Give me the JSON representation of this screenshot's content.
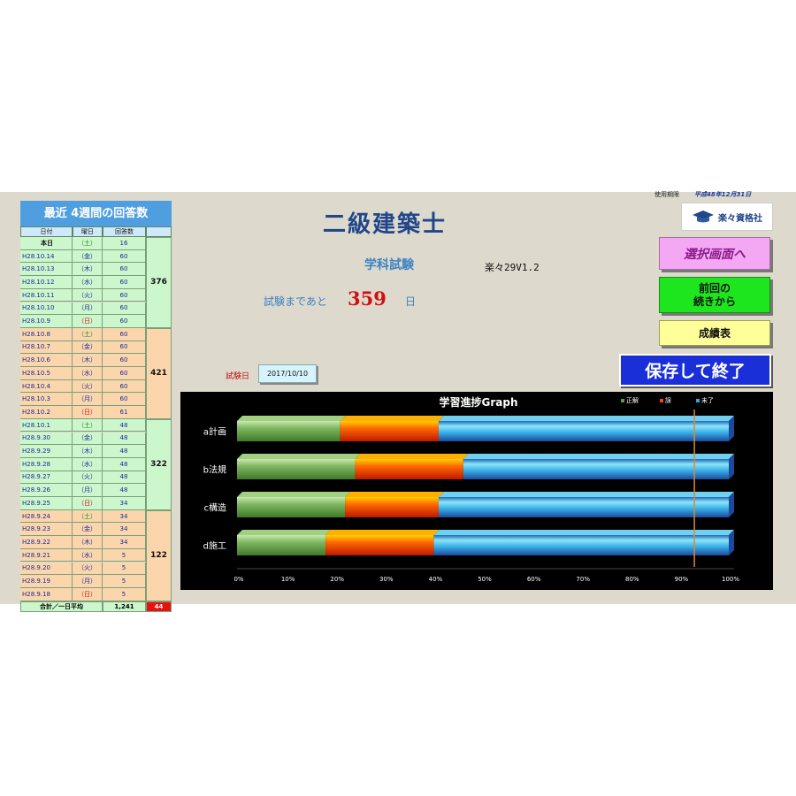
{
  "left_panel": {
    "title": "最近 4週間の回答数",
    "headers": [
      "日付",
      "曜日",
      "回答数"
    ],
    "groups": [
      {
        "color": "#ccf6cc",
        "total": "376",
        "rows": [
          {
            "date": "本日",
            "day": "（土）",
            "count": "16",
            "today": true
          },
          {
            "date": "H28.10.14",
            "day": "（金）",
            "count": "60"
          },
          {
            "date": "H28.10.13",
            "day": "（木）",
            "count": "60"
          },
          {
            "date": "H28.10.12",
            "day": "（水）",
            "count": "60"
          },
          {
            "date": "H28.10.11",
            "day": "（火）",
            "count": "60"
          },
          {
            "date": "H28.10.10",
            "day": "（月）",
            "count": "60"
          },
          {
            "date": "H28.10.9",
            "day": "（日）",
            "count": "60"
          }
        ]
      },
      {
        "color": "#fbd6ad",
        "total": "421",
        "rows": [
          {
            "date": "H28.10.8",
            "day": "（土）",
            "count": "60"
          },
          {
            "date": "H28.10.7",
            "day": "（金）",
            "count": "60"
          },
          {
            "date": "H28.10.6",
            "day": "（木）",
            "count": "60"
          },
          {
            "date": "H28.10.5",
            "day": "（水）",
            "count": "60"
          },
          {
            "date": "H28.10.4",
            "day": "（火）",
            "count": "60"
          },
          {
            "date": "H28.10.3",
            "day": "（月）",
            "count": "60"
          },
          {
            "date": "H28.10.2",
            "day": "（日）",
            "count": "61"
          }
        ]
      },
      {
        "color": "#ccf6cc",
        "total": "322",
        "rows": [
          {
            "date": "H28.10.1",
            "day": "（土）",
            "count": "48"
          },
          {
            "date": "H28.9.30",
            "day": "（金）",
            "count": "48"
          },
          {
            "date": "H28.9.29",
            "day": "（木）",
            "count": "48"
          },
          {
            "date": "H28.9.28",
            "day": "（水）",
            "count": "48"
          },
          {
            "date": "H28.9.27",
            "day": "（火）",
            "count": "48"
          },
          {
            "date": "H28.9.26",
            "day": "（月）",
            "count": "48"
          },
          {
            "date": "H28.9.25",
            "day": "（日）",
            "count": "34"
          }
        ]
      },
      {
        "color": "#fbd6ad",
        "total": "122",
        "rows": [
          {
            "date": "H28.9.24",
            "day": "（土）",
            "count": "34"
          },
          {
            "date": "H28.9.23",
            "day": "（金）",
            "count": "34"
          },
          {
            "date": "H28.9.22",
            "day": "（木）",
            "count": "34"
          },
          {
            "date": "H28.9.21",
            "day": "（水）",
            "count": "5"
          },
          {
            "date": "H28.9.20",
            "day": "（火）",
            "count": "5"
          },
          {
            "date": "H28.9.19",
            "day": "（月）",
            "count": "5"
          },
          {
            "date": "H28.9.18",
            "day": "（日）",
            "count": "5"
          }
        ]
      }
    ],
    "footer": {
      "label": "合計／一日平均",
      "total": "1,241",
      "average": "44"
    }
  },
  "header": {
    "app_title": "二級建築士",
    "subtitle": "学科試験",
    "version": "楽々29V1.2",
    "countdown_label": "試験まであと",
    "countdown_days": "359",
    "countdown_unit": "日",
    "exam_date_label": "試験日",
    "exam_date": "2017/10/10",
    "license_label": "使用期限",
    "license_date": "平成48年12月31日",
    "logo_text": "楽々資格社",
    "logo_icon": "graduation-cap-icon"
  },
  "buttons": {
    "select_screen": "選択画面へ",
    "continue_line1": "前回の",
    "continue_line2": "続きから",
    "results": "成績表",
    "save_exit": "保存して終了"
  },
  "chart_data": {
    "type": "bar",
    "orientation": "horizontal-stacked-percent",
    "title": "学習進捗Graph",
    "categories": [
      "a計画",
      "b法規",
      "c構造",
      "d施工"
    ],
    "series": [
      {
        "name": "正解",
        "color": "#5e9a3e",
        "values": [
          21,
          24,
          22,
          18
        ]
      },
      {
        "name": "誤",
        "color": "#ff4400",
        "values": [
          20,
          22,
          19,
          22
        ]
      },
      {
        "name": "未了",
        "color": "#2aa5e8",
        "values": [
          59,
          54,
          59,
          60
        ]
      }
    ],
    "x_ticks": [
      "0%",
      "10%",
      "20%",
      "30%",
      "40%",
      "50%",
      "60%",
      "70%",
      "80%",
      "90%",
      "100%"
    ],
    "xlim": [
      0,
      100
    ],
    "target_line": 93,
    "legend_position": "top-right",
    "background": "#000000"
  }
}
